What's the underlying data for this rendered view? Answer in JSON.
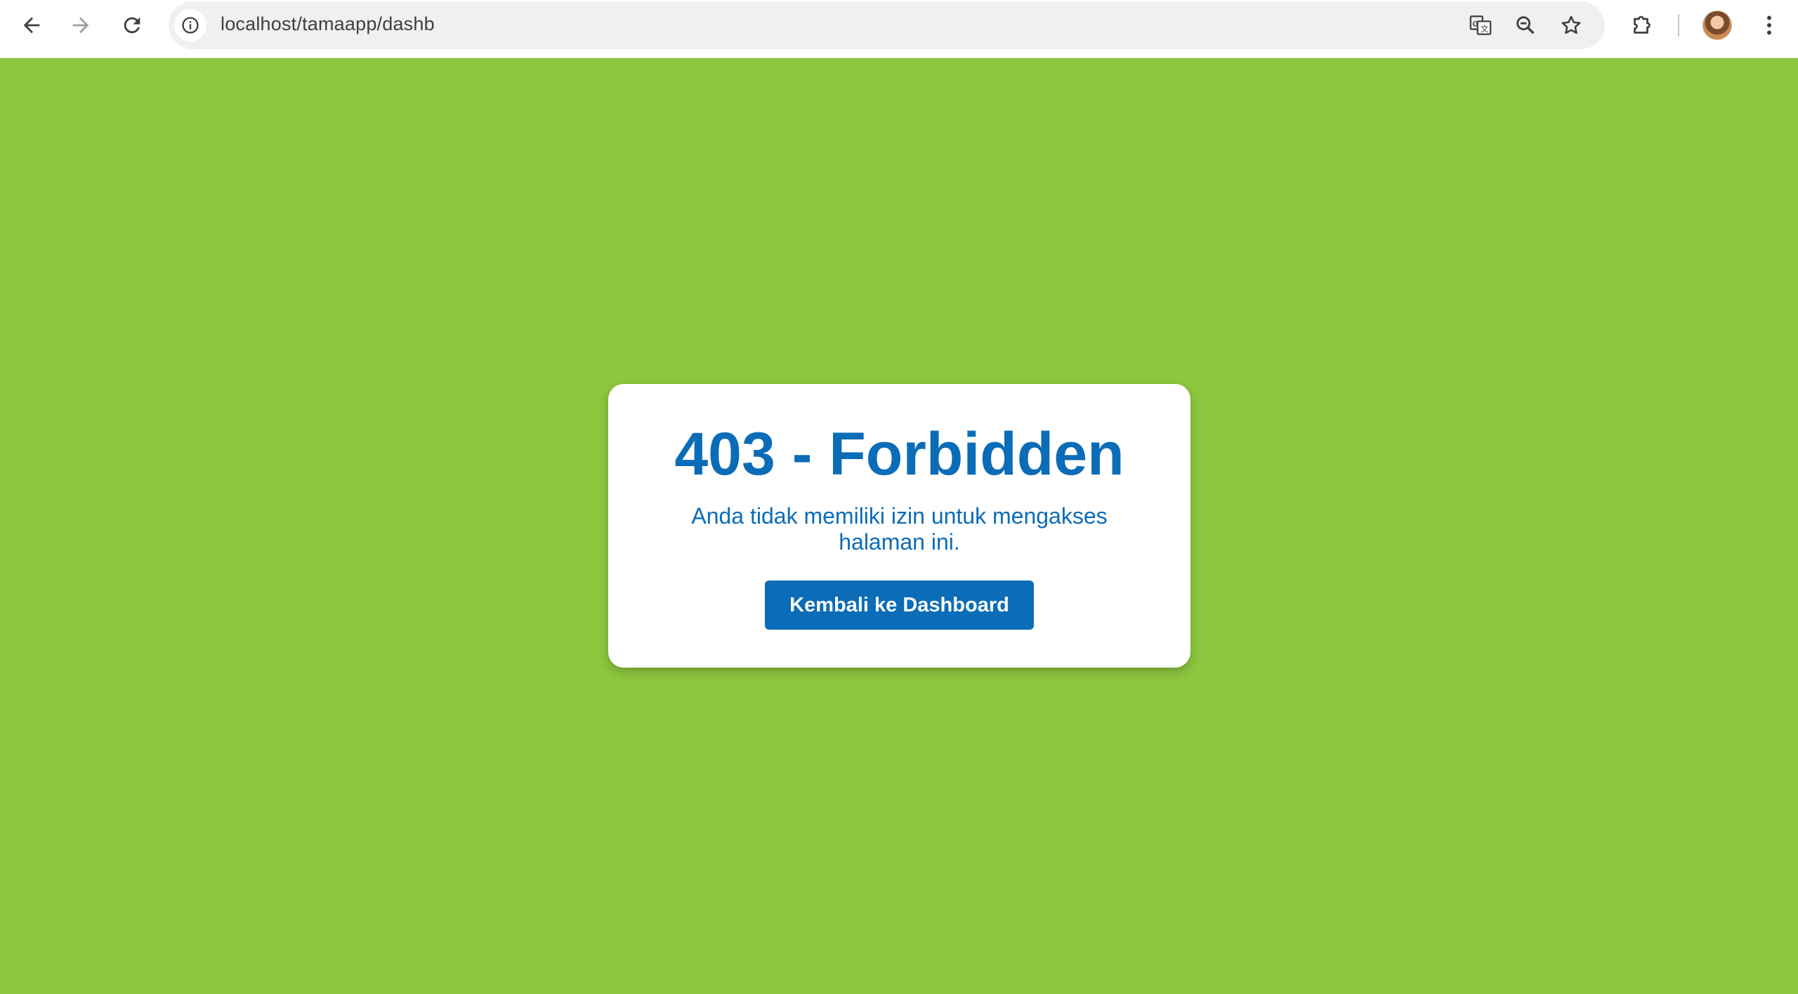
{
  "browser": {
    "url": "localhost/tamaapp/dashb",
    "icons": {
      "back": "back-arrow-icon",
      "forward": "forward-arrow-icon",
      "reload": "reload-icon",
      "site_info": "info-icon",
      "translate": "translate-icon",
      "zoom": "zoom-out-icon",
      "bookmark": "star-icon",
      "extensions": "puzzle-icon",
      "profile": "avatar",
      "menu": "kebab-menu-icon"
    }
  },
  "page": {
    "background_color": "#8dc63f",
    "accent_color": "#0b6cb8",
    "title": "403 - Forbidden",
    "message": "Anda tidak memiliki izin untuk mengakses halaman ini.",
    "button_label": "Kembali ke Dashboard"
  }
}
